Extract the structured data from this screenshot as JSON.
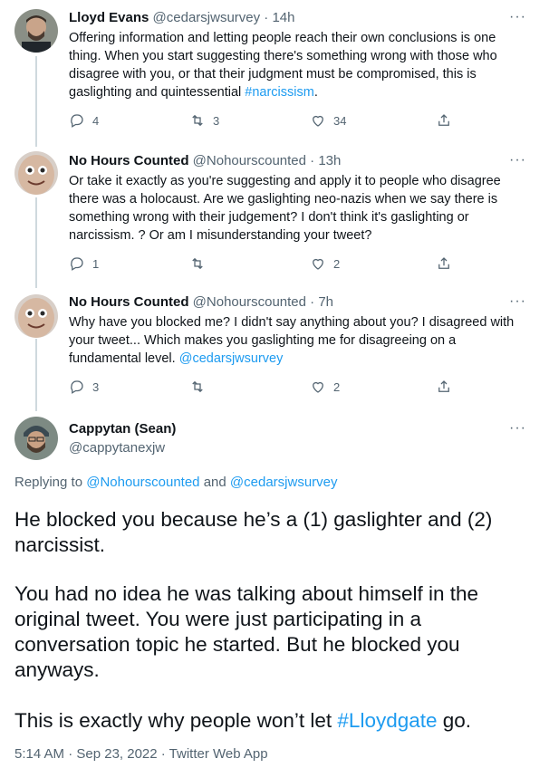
{
  "tweets": [
    {
      "name": "Lloyd Evans",
      "handle": "@cedarsjwsurvey",
      "time": "· 14h",
      "text_parts": [
        "Offering information and letting people reach their own conclusions is one thing. When you start suggesting there's something wrong with those who disagree with you, or that their judgment must be compromised, this is gaslighting and quintessential ",
        "#narcissism",
        "."
      ],
      "replies": "4",
      "retweets": "3",
      "likes": "34"
    },
    {
      "name": "No Hours Counted",
      "handle": "@Nohourscounted",
      "time": "· 13h",
      "text": "Or take it exactly as you're suggesting and apply it to people who disagree there was a holocaust. Are we gaslighting neo-nazis when we say there is something wrong with their judgement? I don't think it's gaslighting or narcissism. ? Or am I misunderstanding your tweet?",
      "replies": "1",
      "retweets": "",
      "likes": "2"
    },
    {
      "name": "No Hours Counted",
      "handle": "@Nohourscounted",
      "time": "· 7h",
      "text_parts": [
        "Why have you blocked me? I didn't say anything about you? I disagreed with your tweet... Which makes you gaslighting me for disagreeing on a fundamental level. ",
        "@cedarsjwsurvey"
      ],
      "replies": "3",
      "retweets": "",
      "likes": "2"
    }
  ],
  "main": {
    "name": "Cappytan (Sean)",
    "handle": "@cappytanexjw",
    "replying_prefix": "Replying to ",
    "replying_user1": "@Nohourscounted",
    "replying_and": " and ",
    "replying_user2": "@cedarsjwsurvey",
    "para1": "He blocked you because he’s a (1) gaslighter and (2) narcissist.",
    "para2": "You had no idea he was talking about himself in the original tweet. You were just participating in a conversation topic he started. But he blocked you anyways.",
    "para3_prefix": "This is exactly why people won’t let ",
    "para3_hashtag": "#Lloydgate",
    "para3_suffix": " go.",
    "timestamp": "5:14 AM · Sep 23, 2022 · Twitter Web App"
  },
  "more_label": "···",
  "colors": {
    "link": "#1d9bf0",
    "muted": "#536471",
    "thread": "#cfd9de"
  }
}
